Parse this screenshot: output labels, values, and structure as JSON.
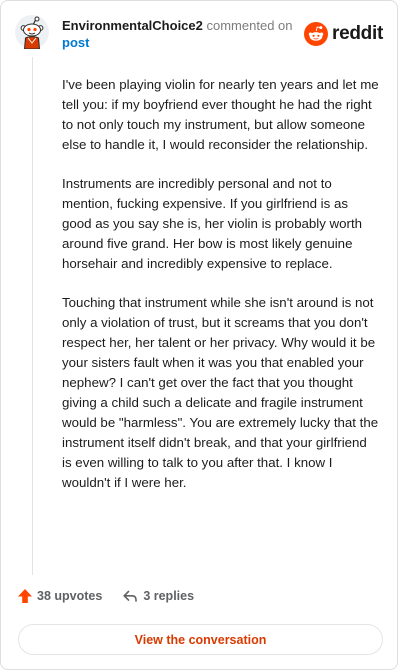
{
  "header": {
    "username": "EnvironmentalChoice2",
    "action_text": "commented on",
    "post_link": "post",
    "avatar_icon": "reddit-snoo-avatar-icon",
    "brand": "reddit",
    "brand_color": "#ff4500"
  },
  "comment": {
    "paragraphs": [
      "I've been playing violin for nearly ten years and let me tell you: if my boyfriend ever thought he had the right to not only touch my instrument, but allow someone else to handle it, I would reconsider the relationship.",
      "Instruments are incredibly personal and not to mention, fucking expensive. If you girlfriend is as good as you say she is, her violin is probably worth around five grand. Her bow is most likely genuine horsehair and incredibly expensive to replace.",
      "Touching that instrument while she isn't around is not only a violation of trust, but it screams that you don't respect her, her talent or her privacy. Why would it be your sisters fault when it was you that enabled your nephew? I can't get over the fact that you thought giving a child such a delicate and fragile instrument would be \"harmless\". You are extremely lucky that the instrument itself didn't break, and that your girlfriend is even willing to talk to you after that. I know I wouldn't if I were her."
    ]
  },
  "actions": {
    "upvotes_label": "38 upvotes",
    "upvote_icon": "upvote-arrow-icon",
    "upvote_color": "#ff4500",
    "replies_label": "3 replies",
    "reply_icon": "reply-arrow-icon"
  },
  "footer": {
    "view_conversation_label": "View the conversation",
    "accent_color": "#d93a00"
  }
}
